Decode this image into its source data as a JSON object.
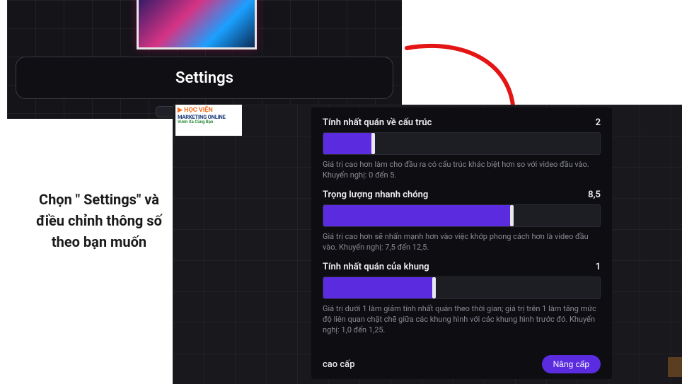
{
  "settings_button_label": "Settings",
  "instruction_text": "Chọn \" Settings\" và điều chỉnh thông số theo bạn muốn",
  "logo": {
    "line1": "▶ HỌC VIỆN",
    "line2": "MARKETING ONLINE",
    "line3": "Vươn Xa Cùng Bạn"
  },
  "sliders": [
    {
      "label": "Tính nhất quán về cấu trúc",
      "value_display": "2",
      "fill_pct": 18,
      "desc": "Giá trị cao hơn làm cho đầu ra có cấu trúc khác biệt hơn so với video đầu vào. Khuyến nghị: 0 đến 5."
    },
    {
      "label": "Trọng lượng nhanh chóng",
      "value_display": "8,5",
      "fill_pct": 68,
      "desc": "Giá trị cao hơn sẽ nhấn mạnh hơn vào việc khớp phong cách hơn là video đầu vào. Khuyến nghị: 7,5 đến 12,5."
    },
    {
      "label": "Tính nhất quán của khung",
      "value_display": "1",
      "fill_pct": 40,
      "desc": "Giá trị dưới 1 làm giảm tính nhất quán theo thời gian; giá trị trên 1 làm tăng mức độ liên quan chặt chẽ giữa các khung hình với các khung hình trước đó. Khuyến nghị: 1,0 đến 1,25."
    }
  ],
  "footer": {
    "label": "cao cấp",
    "button": "Nâng cấp"
  },
  "colors": {
    "accent": "#5b2be0",
    "arrow": "#e41515"
  }
}
